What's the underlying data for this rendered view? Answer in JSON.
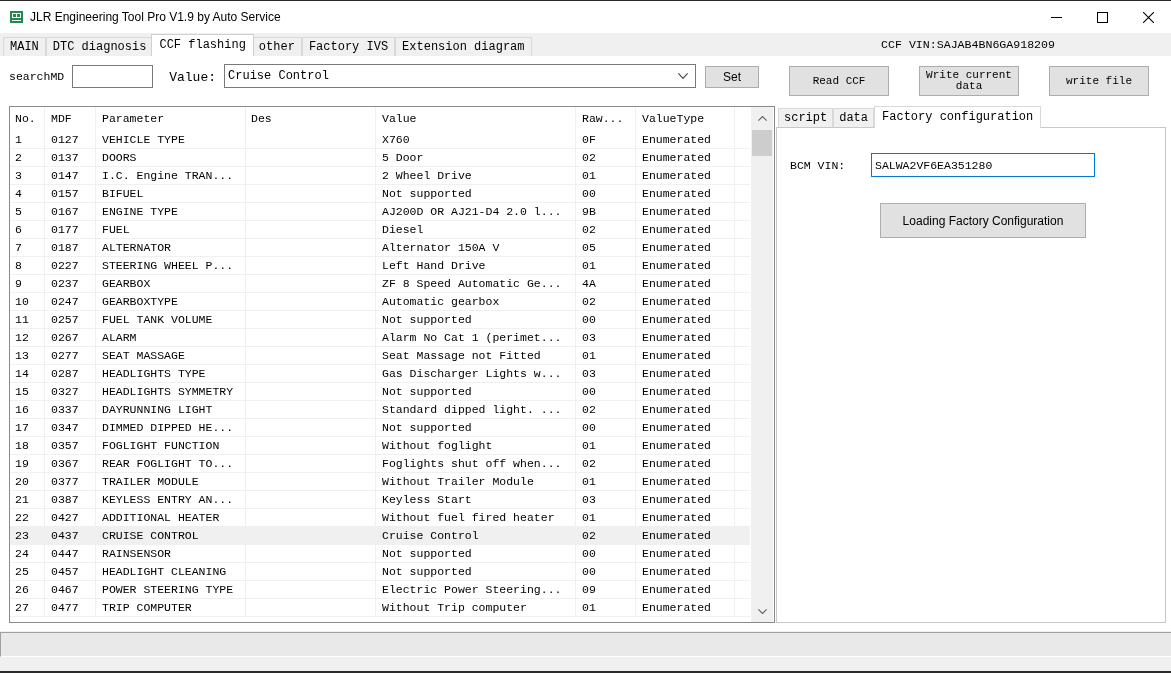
{
  "window": {
    "title": "JLR Engineering Tool Pro V1.9 by Auto Service"
  },
  "tabs": [
    {
      "label": "MAIN",
      "selected": false
    },
    {
      "label": "DTC diagnosis",
      "selected": false
    },
    {
      "label": "CCF flashing",
      "selected": true
    },
    {
      "label": "other",
      "selected": false
    },
    {
      "label": "Factory IVS",
      "selected": false
    },
    {
      "label": "Extension diagram",
      "selected": false
    }
  ],
  "ccf_vin": "CCF VIN:SAJAB4BN6GA918209",
  "search": {
    "label": "searchMD"
  },
  "value_picker": {
    "label": "Value:",
    "value": "Cruise Control"
  },
  "buttons": [
    {
      "label": "Set",
      "kind": "small"
    },
    {
      "label": "Read CCF",
      "kind": "large"
    },
    {
      "label": "Write current data",
      "kind": "large"
    },
    {
      "label": "write file",
      "kind": "large"
    }
  ],
  "table": {
    "columns": [
      "No.",
      "MDF",
      "Parameter",
      "Des",
      "Value",
      "Raw...",
      "ValueType"
    ],
    "rows": [
      {
        "no": "1",
        "mdf": "0127",
        "parameter": "VEHICLE TYPE",
        "value": "X760",
        "raw": "0F",
        "value_type": "Enumerated",
        "selected": false
      },
      {
        "no": "2",
        "mdf": "0137",
        "parameter": "DOORS",
        "value": "5 Door",
        "raw": "02",
        "value_type": "Enumerated",
        "selected": false
      },
      {
        "no": "3",
        "mdf": "0147",
        "parameter": "I.C. Engine TRAN...",
        "value": "2 Wheel Drive",
        "raw": "01",
        "value_type": "Enumerated",
        "selected": false
      },
      {
        "no": "4",
        "mdf": "0157",
        "parameter": "BIFUEL",
        "value": "Not supported",
        "raw": "00",
        "value_type": "Enumerated",
        "selected": false
      },
      {
        "no": "5",
        "mdf": "0167",
        "parameter": "ENGINE TYPE",
        "value": "AJ200D OR AJ21-D4 2.0 l...",
        "raw": "9B",
        "value_type": "Enumerated",
        "selected": false
      },
      {
        "no": "6",
        "mdf": "0177",
        "parameter": "FUEL",
        "value": "Diesel",
        "raw": "02",
        "value_type": "Enumerated",
        "selected": false
      },
      {
        "no": "7",
        "mdf": "0187",
        "parameter": "ALTERNATOR",
        "value": "Alternator 150A V",
        "raw": "05",
        "value_type": "Enumerated",
        "selected": false
      },
      {
        "no": "8",
        "mdf": "0227",
        "parameter": "STEERING WHEEL P...",
        "value": "Left Hand Drive",
        "raw": "01",
        "value_type": "Enumerated",
        "selected": false
      },
      {
        "no": "9",
        "mdf": "0237",
        "parameter": "GEARBOX",
        "value": "ZF 8 Speed Automatic Ge...",
        "raw": "4A",
        "value_type": "Enumerated",
        "selected": false
      },
      {
        "no": "10",
        "mdf": "0247",
        "parameter": "GEARBOXTYPE",
        "value": "Automatic gearbox",
        "raw": "02",
        "value_type": "Enumerated",
        "selected": false
      },
      {
        "no": "11",
        "mdf": "0257",
        "parameter": "FUEL TANK VOLUME",
        "value": "Not supported",
        "raw": "00",
        "value_type": "Enumerated",
        "selected": false
      },
      {
        "no": "12",
        "mdf": "0267",
        "parameter": "ALARM",
        "value": "Alarm No Cat 1 (perimet...",
        "raw": "03",
        "value_type": "Enumerated",
        "selected": false
      },
      {
        "no": "13",
        "mdf": "0277",
        "parameter": "SEAT MASSAGE",
        "value": "Seat Massage not Fitted",
        "raw": "01",
        "value_type": "Enumerated",
        "selected": false
      },
      {
        "no": "14",
        "mdf": "0287",
        "parameter": "HEADLIGHTS TYPE",
        "value": "Gas Discharger Lights w...",
        "raw": "03",
        "value_type": "Enumerated",
        "selected": false
      },
      {
        "no": "15",
        "mdf": "0327",
        "parameter": "HEADLIGHTS SYMMETRY",
        "value": "Not supported",
        "raw": "00",
        "value_type": "Enumerated",
        "selected": false
      },
      {
        "no": "16",
        "mdf": "0337",
        "parameter": "DAYRUNNING LIGHT",
        "value": "Standard dipped light. ...",
        "raw": "02",
        "value_type": "Enumerated",
        "selected": false
      },
      {
        "no": "17",
        "mdf": "0347",
        "parameter": "DIMMED DIPPED HE...",
        "value": "Not supported",
        "raw": "00",
        "value_type": "Enumerated",
        "selected": false
      },
      {
        "no": "18",
        "mdf": "0357",
        "parameter": "FOGLIGHT FUNCTION",
        "value": "Without foglight",
        "raw": "01",
        "value_type": "Enumerated",
        "selected": false
      },
      {
        "no": "19",
        "mdf": "0367",
        "parameter": "REAR FOGLIGHT TO...",
        "value": "Foglights shut off when...",
        "raw": "02",
        "value_type": "Enumerated",
        "selected": false
      },
      {
        "no": "20",
        "mdf": "0377",
        "parameter": "TRAILER MODULE",
        "value": "Without Trailer Module",
        "raw": "01",
        "value_type": "Enumerated",
        "selected": false
      },
      {
        "no": "21",
        "mdf": "0387",
        "parameter": "KEYLESS ENTRY AN...",
        "value": "Keyless Start",
        "raw": "03",
        "value_type": "Enumerated",
        "selected": false
      },
      {
        "no": "22",
        "mdf": "0427",
        "parameter": "ADDITIONAL HEATER",
        "value": "Without fuel fired heater",
        "raw": "01",
        "value_type": "Enumerated",
        "selected": false
      },
      {
        "no": "23",
        "mdf": "0437",
        "parameter": "CRUISE CONTROL",
        "value": "Cruise Control",
        "raw": "02",
        "value_type": "Enumerated",
        "selected": true
      },
      {
        "no": "24",
        "mdf": "0447",
        "parameter": "RAINSENSOR",
        "value": "Not supported",
        "raw": "00",
        "value_type": "Enumerated",
        "selected": false
      },
      {
        "no": "25",
        "mdf": "0457",
        "parameter": "HEADLIGHT CLEANING",
        "value": "Not supported",
        "raw": "00",
        "value_type": "Enumerated",
        "selected": false
      },
      {
        "no": "26",
        "mdf": "0467",
        "parameter": "POWER STEERING TYPE",
        "value": "Electric Power Steering...",
        "raw": "09",
        "value_type": "Enumerated",
        "selected": false
      },
      {
        "no": "27",
        "mdf": "0477",
        "parameter": "TRIP COMPUTER",
        "value": "Without Trip computer",
        "raw": "01",
        "value_type": "Enumerated",
        "selected": false
      }
    ]
  },
  "side_panel": {
    "tabs": [
      {
        "label": "script",
        "selected": false
      },
      {
        "label": "data",
        "selected": false
      },
      {
        "label": "Factory configuration",
        "selected": true
      }
    ],
    "bcm_vin": {
      "label": "BCM VIN:",
      "value": "SALWA2VF6EA351280"
    },
    "button": "Loading Factory Configuration"
  }
}
